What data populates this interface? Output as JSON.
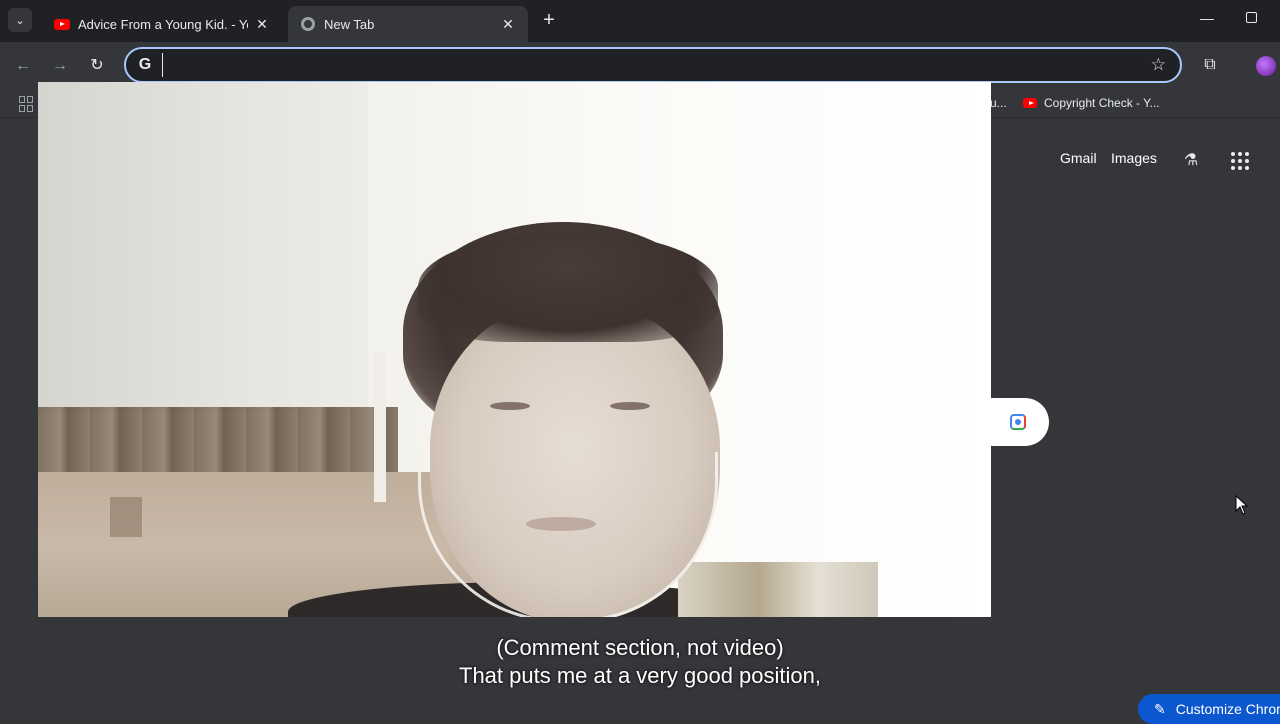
{
  "tabs": [
    {
      "title": "Advice From a Young Kid. - You",
      "favicon": "youtube-icon",
      "active": false
    },
    {
      "title": "New Tab",
      "favicon": "chrome-icon",
      "active": true
    }
  ],
  "toolbar": {
    "address_value": "",
    "search_engine_icon": "google-g-icon"
  },
  "bookmarks": {
    "partial_label": "u...",
    "items": [
      {
        "label": "Copyright Check - Y...",
        "favicon": "youtube-icon"
      }
    ]
  },
  "ntp": {
    "gmail_label": "Gmail",
    "images_label": "Images",
    "customize_label": "Customize Chrom"
  },
  "caption": {
    "line1": "(Comment section, not video)",
    "line2": "That puts me at a very good position,"
  },
  "colors": {
    "titlebar": "#202124",
    "toolbar": "#35363a",
    "omnibox_border": "#a8c7fa",
    "customize_button": "#0b57d0"
  }
}
